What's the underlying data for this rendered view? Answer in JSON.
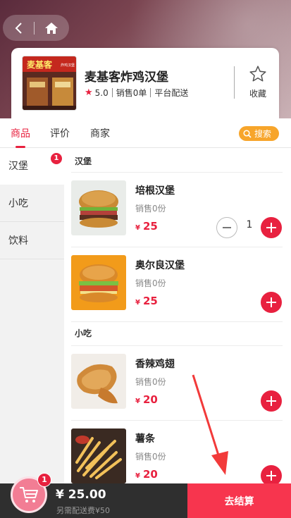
{
  "shop": {
    "name": "麦基客炸鸡汉堡",
    "rating": "5.0",
    "sales": "销售0单",
    "delivery_mode": "平台配送",
    "favorite_label": "收藏",
    "logo_sign_text": "麦基客",
    "logo_sign_sub": "炸鸡汉堡"
  },
  "tabs": [
    {
      "label": "商品",
      "active": true
    },
    {
      "label": "评价",
      "active": false
    },
    {
      "label": "商家",
      "active": false
    }
  ],
  "search_label": "搜索",
  "categories": [
    {
      "label": "汉堡",
      "badge": "1",
      "active": true
    },
    {
      "label": "小吃",
      "badge": "",
      "active": false
    },
    {
      "label": "饮料",
      "badge": "",
      "active": false
    }
  ],
  "sections": [
    {
      "title": "汉堡",
      "products": [
        {
          "name": "培根汉堡",
          "sold": "销售0份",
          "currency": "¥",
          "price": "25",
          "qty": "1"
        },
        {
          "name": "奥尔良汉堡",
          "sold": "销售0份",
          "currency": "¥",
          "price": "25",
          "qty": ""
        }
      ]
    },
    {
      "title": "小吃",
      "products": [
        {
          "name": "香辣鸡翅",
          "sold": "销售0份",
          "currency": "¥",
          "price": "20",
          "qty": ""
        },
        {
          "name": "薯条",
          "sold": "销售0份",
          "currency": "¥",
          "price": "20",
          "qty": ""
        }
      ]
    }
  ],
  "cart": {
    "badge": "1",
    "total": "¥ 25.00",
    "delivery_note": "另需配送费¥50",
    "checkout_label": "去结算"
  },
  "colors": {
    "accent": "#e8213f",
    "search": "#f7a52b",
    "bottom_bar": "#2f2f2f"
  }
}
